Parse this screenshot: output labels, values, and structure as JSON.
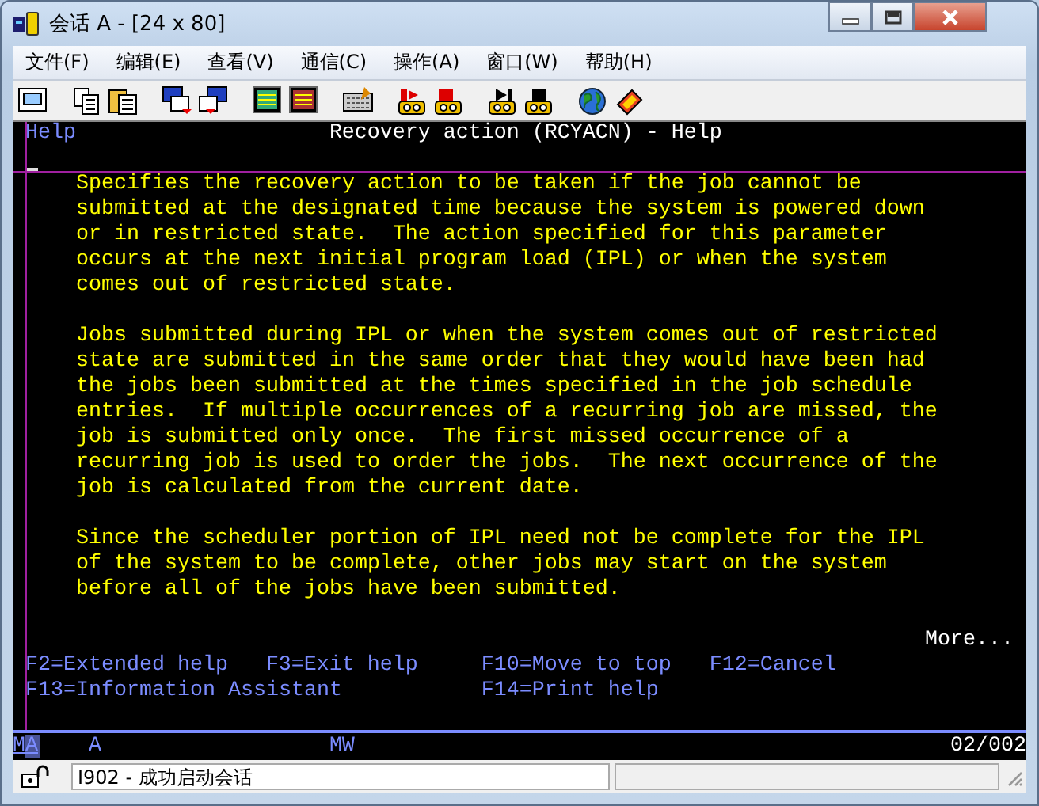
{
  "window": {
    "title": "会话 A - [24 x 80]"
  },
  "menu": [
    "文件(F)",
    "编辑(E)",
    "查看(V)",
    "通信(C)",
    "操作(A)",
    "窗口(W)",
    "帮助(H)"
  ],
  "screen": {
    "panel": "Help",
    "title": "Recovery action (RCYACN) - Help",
    "paragraphs": [
      [
        "Specifies the recovery action to be taken if the job cannot be",
        "submitted at the designated time because the system is powered down",
        "or in restricted state.  The action specified for this parameter",
        "occurs at the next initial program load (IPL) or when the system",
        "comes out of restricted state."
      ],
      [
        "Jobs submitted during IPL or when the system comes out of restricted",
        "state are submitted in the same order that they would have been had",
        "the jobs been submitted at the times specified in the job schedule",
        "entries.  If multiple occurrences of a recurring job are missed, the",
        "job is submitted only once.  The first missed occurrence of a",
        "recurring job is used to order the jobs.  The next occurrence of the",
        "job is calculated from the current date."
      ],
      [
        "Since the scheduler portion of IPL need not be complete for the IPL",
        "of the system to be complete, other jobs may start on the system",
        "before all of the jobs have been submitted."
      ]
    ],
    "more": "More...",
    "function_keys": [
      [
        "F2=Extended help",
        "F3=Exit help",
        "F10=Move to top",
        "F12=Cancel"
      ],
      [
        "F13=Information Assistant",
        "F14=Print help"
      ]
    ]
  },
  "oia": {
    "fields": [
      "MA",
      "A",
      "MW"
    ],
    "position": "02/002"
  },
  "status_bar": {
    "message": "I902 - 成功启动会话"
  }
}
